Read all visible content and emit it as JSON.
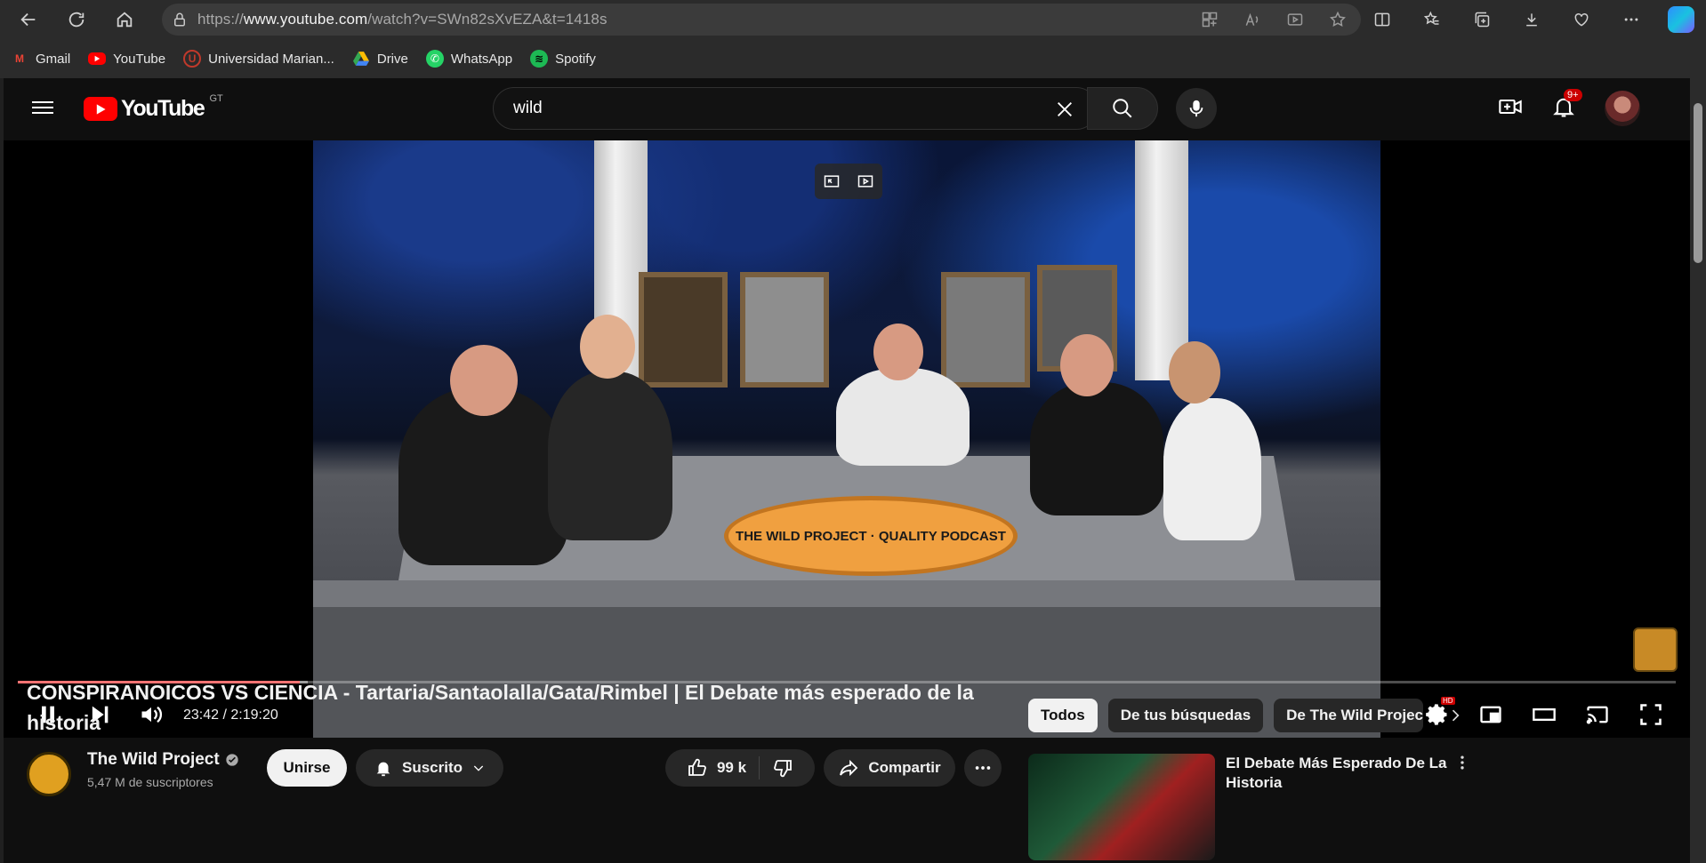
{
  "browser": {
    "url_prefix": "https://",
    "url_host": "www.youtube.com",
    "url_path": "/watch?v=SWn82sXvEZA&t=1418s"
  },
  "bookmarks": [
    {
      "label": "Gmail",
      "icon": "gmail-icon",
      "color": "#ea4335"
    },
    {
      "label": "YouTube",
      "icon": "youtube-icon",
      "color": "#ff0000"
    },
    {
      "label": "Universidad Marian...",
      "icon": "university-icon",
      "color": "#c0392b"
    },
    {
      "label": "Drive",
      "icon": "drive-icon",
      "color": "#fbbc04"
    },
    {
      "label": "WhatsApp",
      "icon": "whatsapp-icon",
      "color": "#25d366"
    },
    {
      "label": "Spotify",
      "icon": "spotify-icon",
      "color": "#1db954"
    }
  ],
  "header": {
    "logo_text": "YouTube",
    "region": "GT",
    "search_value": "wild",
    "notifications_badge": "9+"
  },
  "player": {
    "current_time": "23:42",
    "duration": "2:19:20",
    "time_display": "23:42 / 2:19:20",
    "progress_fraction": 0.17,
    "buffered_fraction": 0.175,
    "settings_badge": "HD",
    "accent": "#ff0000",
    "video_overlay_text": "THE WILD PROJECT · QUALITY PODCAST"
  },
  "video": {
    "title": "CONSPIRANOICOS VS CIENCIA - Tartaria/Santaolalla/Gata/Rimbel | El Debate más esperado de la historia",
    "channel": "The Wild Project",
    "subscribers": "5,47 M de suscriptores",
    "join_label": "Unirse",
    "subscribed_label": "Suscrito",
    "likes": "99 k",
    "share_label": "Compartir"
  },
  "chips": [
    {
      "label": "Todos",
      "active": true
    },
    {
      "label": "De tus búsquedas",
      "active": false
    },
    {
      "label": "De The Wild Project",
      "active": false
    }
  ],
  "recommendation": {
    "title": "El Debate Más Esperado De La Historia"
  }
}
